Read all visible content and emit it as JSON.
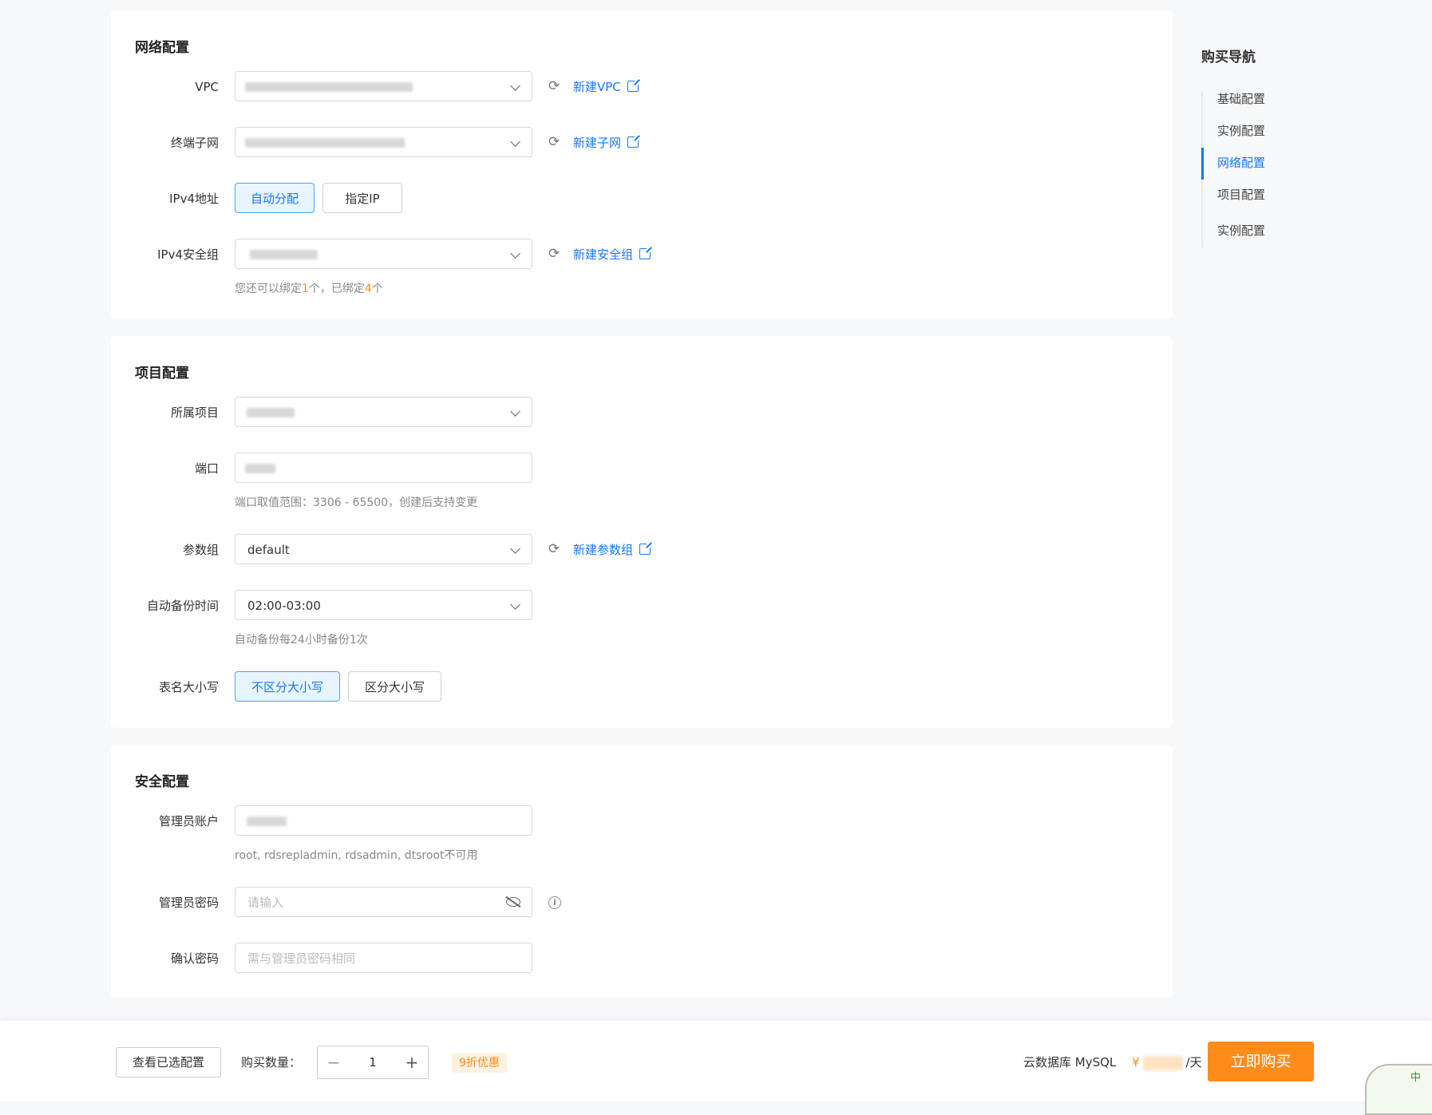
{
  "network": {
    "title": "网络配置",
    "vpc_label": "VPC",
    "vpc_link": "新建VPC",
    "subnet_label": "终端子网",
    "subnet_link": "新建子网",
    "ipv4_label": "IPv4地址",
    "ipv4_options": [
      "自动分配",
      "指定IP"
    ],
    "sg_label": "IPv4安全组",
    "sg_link": "新建安全组",
    "sg_hint_prefix": "您还可以绑定",
    "sg_hint_count1": "1",
    "sg_hint_mid": "个，已绑定",
    "sg_hint_count2": "4",
    "sg_hint_suffix": "个"
  },
  "project": {
    "title": "项目配置",
    "project_label": "所属项目",
    "port_label": "端口",
    "port_hint": "端口取值范围：3306 - 65500，创建后支持变更",
    "param_label": "参数组",
    "param_value": "default",
    "param_link": "新建参数组",
    "backup_label": "自动备份时间",
    "backup_value": "02:00-03:00",
    "backup_hint": "自动备份每24小时备份1次",
    "case_label": "表名大小写",
    "case_options": [
      "不区分大小写",
      "区分大小写"
    ]
  },
  "security": {
    "title": "安全配置",
    "admin_label": "管理员账户",
    "admin_hint": "root, rdsrepladmin, rdsadmin, dtsroot不可用",
    "password_label": "管理员密码",
    "password_placeholder": "请输入",
    "confirm_label": "确认密码",
    "confirm_placeholder": "需与管理员密码相同"
  },
  "nav": {
    "title": "购买导航",
    "items": [
      "基础配置",
      "实例配置",
      "网络配置",
      "项目配置",
      "实例配置"
    ],
    "active_index": 2
  },
  "footer": {
    "view_selected": "查看已选配置",
    "qty_label": "购买数量：",
    "qty_minus": "−",
    "qty_value": "1",
    "qty_plus": "+",
    "discount": "9折优惠",
    "product": "云数据库 MySQL",
    "currency": "¥",
    "price_unit": "/天",
    "buy": "立即购买",
    "corner_text": "中"
  },
  "colors": {
    "accent": "#1677ff",
    "orange": "#ff8c1a",
    "background": "#f7f8fa"
  },
  "icons": {
    "refresh": "refresh-icon",
    "external_link": "external-link-icon",
    "chevron": "chevron-down-icon",
    "eye_off": "eye-off-icon",
    "info": "info-icon"
  }
}
